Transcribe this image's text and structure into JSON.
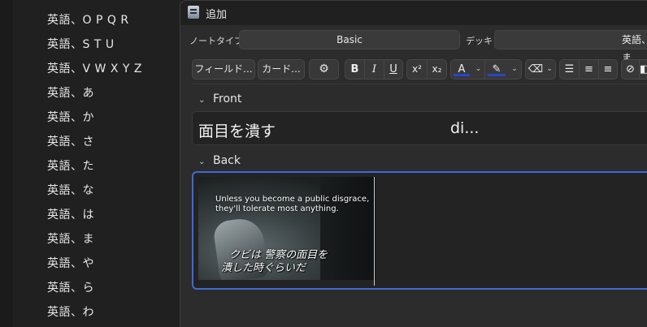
{
  "deck_list": {
    "items": [
      "英語、O P Q R",
      "英語、S T U",
      "英語、V W X Y Z",
      "英語、あ",
      "英語、か",
      "英語、さ",
      "英語、た",
      "英語、な",
      "英語、は",
      "英語、ま",
      "英語、や",
      "英語、ら",
      "英語、わ"
    ]
  },
  "window": {
    "title": "追加"
  },
  "type_row": {
    "note_type_label": "ノートタイプ",
    "note_type_value": "Basic",
    "deck_label": "デッキ",
    "deck_value": "英語、ま"
  },
  "toolbar": {
    "fields_label": "フィールド...",
    "cards_label": "カード...",
    "gear_glyph": "⚙",
    "bold": "B",
    "italic": "I",
    "underline": "U",
    "superscript": "x²",
    "subscript": "x₂",
    "text_color": "A",
    "highlight_glyph": "✎",
    "chevron": "⌄",
    "eraser_glyph": "⌫",
    "bullet_list_glyph": "☰",
    "numbered_list_glyph": "≡",
    "align_glyph": "≡",
    "attach_glyph": "⊘",
    "extra_glyph": "◧",
    "text_color_hex": "#2a45c8",
    "highlight_color_hex": "#2a45c8"
  },
  "fields": {
    "front_label": "Front",
    "front_text": "面目を潰す",
    "front_text_2": "di...",
    "back_label": "Back",
    "back_image": {
      "caption_en_1": "Unless you become a public disgrace,",
      "caption_en_2": "they'll tolerate most anything.",
      "caption_jp_1": "クビは 警察の面目を",
      "caption_jp_2": "潰した時ぐらいだ"
    }
  },
  "colors": {
    "accent": "#3d6bd1",
    "background": "#2c2c2c"
  }
}
